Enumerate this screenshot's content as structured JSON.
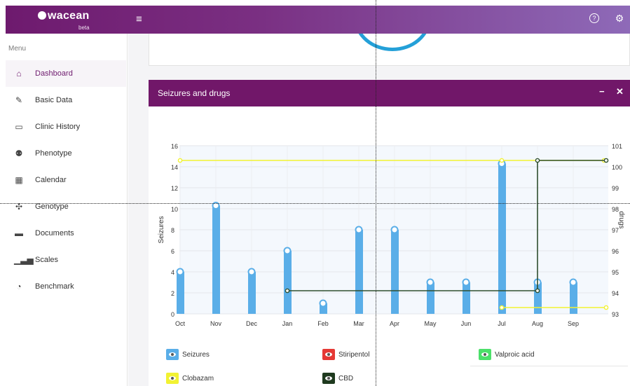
{
  "app": {
    "logo": "wacean",
    "logo_sub": "beta"
  },
  "icons": {
    "menu": "hamburger-icon",
    "help": "question-circle-icon",
    "settings": "gear-icon",
    "panel_minimize": "minus-icon",
    "panel_close": "close-icon"
  },
  "sidebar": {
    "title": "Menu",
    "items": [
      {
        "label": "Dashboard",
        "icon": "home-icon",
        "active": true
      },
      {
        "label": "Basic Data",
        "icon": "edit-icon",
        "active": false
      },
      {
        "label": "Clinic History",
        "icon": "folder-open-icon",
        "active": false
      },
      {
        "label": "Phenotype",
        "icon": "family-tree-icon",
        "active": false
      },
      {
        "label": "Calendar",
        "icon": "calendar-icon",
        "active": false
      },
      {
        "label": "Genotype",
        "icon": "paw-icon",
        "active": false
      },
      {
        "label": "Documents",
        "icon": "document-icon",
        "active": false
      },
      {
        "label": "Scales",
        "icon": "signal-bars-icon",
        "active": false
      },
      {
        "label": "Benchmark",
        "icon": "dial-icon",
        "active": false
      }
    ]
  },
  "panel": {
    "title": "Seizures and drugs"
  },
  "colors": {
    "accent": "#711769",
    "seizures": "#5aaee8",
    "clobazam": "#f2f232",
    "cbd": "#2f4f2f",
    "stiripentol": "#e53935",
    "valproic_acid": "#4ce06a"
  },
  "legend": [
    {
      "label": "Seizures",
      "color": "#5aaee8"
    },
    {
      "label": "Stiripentol",
      "color": "#e53935"
    },
    {
      "label": "Valproic acid",
      "color": "#4ce06a"
    },
    {
      "label": "Clobazam",
      "color": "#f2f232"
    },
    {
      "label": "CBD",
      "color": "#1f3a1f"
    }
  ],
  "chart_data": {
    "type": "bar",
    "ylabel": "Seizures",
    "y2label": "drugs",
    "categories": [
      "Oct",
      "Nov",
      "Dec",
      "Jan",
      "Feb",
      "Mar",
      "Apr",
      "May",
      "Jun",
      "Jul",
      "Aug",
      "Sep"
    ],
    "ylim": [
      0,
      16
    ],
    "y_ticks": [
      0,
      2,
      4,
      6,
      8,
      10,
      12,
      14,
      16
    ],
    "y2lim": [
      93,
      101
    ],
    "y2_ticks": [
      93,
      94,
      95,
      96,
      97,
      98,
      99,
      100,
      101
    ],
    "grid": true,
    "series": [
      {
        "name": "Seizures",
        "type": "bar",
        "axis": "left",
        "values": [
          4,
          10.3,
          4,
          6,
          1,
          8,
          8,
          3,
          3,
          14.3,
          3,
          3
        ]
      },
      {
        "name": "Clobazam",
        "type": "line",
        "axis": "right",
        "points": [
          [
            "Oct",
            100.3
          ],
          [
            "Jul",
            100.3
          ]
        ]
      },
      {
        "name": "Clobazam",
        "type": "line",
        "axis": "right",
        "points": [
          [
            "Jul",
            93.3
          ],
          [
            "Sep",
            93.3
          ]
        ]
      },
      {
        "name": "CBD",
        "type": "line",
        "axis": "right",
        "points": [
          [
            "Jan",
            94.1
          ],
          [
            "Aug",
            94.1
          ],
          [
            "Aug",
            100.3
          ],
          [
            "Sep",
            100.3
          ]
        ]
      }
    ]
  }
}
